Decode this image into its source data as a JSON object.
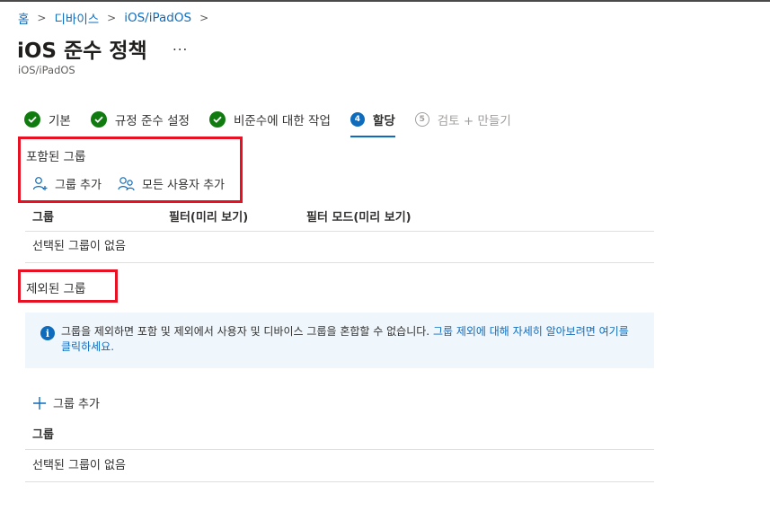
{
  "breadcrumb": {
    "items": [
      "홈",
      "디바이스",
      "iOS/iPadOS"
    ]
  },
  "page": {
    "title": "iOS 준수 정책",
    "more_label": "...",
    "subtitle": "iOS/iPadOS"
  },
  "steps": [
    {
      "label": "기본",
      "state": "complete"
    },
    {
      "label": "규정 준수 설정",
      "state": "complete"
    },
    {
      "label": "비준수에 대한 작업",
      "state": "complete"
    },
    {
      "number": "4",
      "label": "할당",
      "state": "current"
    },
    {
      "number": "5",
      "label": "검토 + 만들기",
      "state": "disabled"
    }
  ],
  "included": {
    "title": "포함된 그룹",
    "add_group_label": "그룹 추가",
    "add_all_users_label": "모든 사용자 추가",
    "columns": [
      "그룹",
      "필터(미리 보기)",
      "필터 모드(미리 보기)"
    ],
    "empty_text": "선택된 그룹이 없음"
  },
  "excluded": {
    "title": "제외된 그룹",
    "info_text": "그룹을 제외하면 포함 및 제외에서 사용자 및 디바이스 그룹을 혼합할 수 없습니다.",
    "info_link": "그룹 제외에 대해 자세히 알아보려면 여기를 클릭하세요.",
    "add_group_label": "그룹 추가",
    "columns": [
      "그룹"
    ],
    "empty_text": "선택된 그룹이 없음"
  },
  "colors": {
    "accent": "#0f6cbd",
    "success": "#107c10",
    "highlight": "#e81123",
    "info_bg": "#eff6fc"
  }
}
